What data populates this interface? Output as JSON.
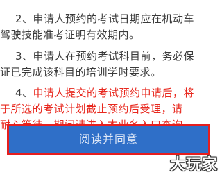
{
  "notice": {
    "item2": {
      "number": "2、",
      "line1": "申请人预约的考试日期应在机动车",
      "line2": "驾驶技能准考证明有效期内。"
    },
    "item3": {
      "number": "3、",
      "line1": "申请人在预约考试科目前，务必保",
      "line2": "证已完成该科目的培训学时要求。"
    },
    "item4": {
      "number": "4、",
      "line1": "申请人提交的考试预约申请后，将",
      "line2": "于所选的考试计划截止预约后受理，请",
      "line3": "耐心等待，期间请进入本业务入口查询"
    }
  },
  "agree_button_label": "阅读并同意",
  "watermark_text": "大玩家",
  "colors": {
    "body_text": "#3a3a3a",
    "highlight_text": "#e8281e",
    "button_bg": "#2f6fc8",
    "button_highlight_border": "#e61e1e"
  }
}
